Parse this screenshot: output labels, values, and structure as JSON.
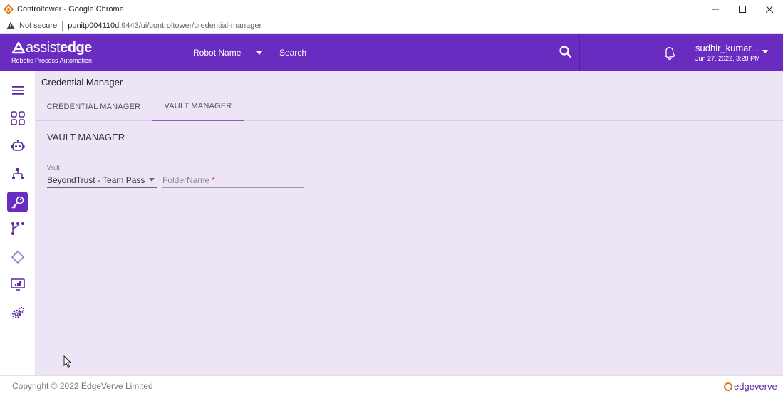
{
  "window": {
    "title": "Controltower - Google Chrome",
    "controls": [
      "minimize",
      "maximize",
      "close"
    ]
  },
  "addressbar": {
    "security_label": "Not secure",
    "url_host": "punitp004110d",
    "url_rest": ":9443/ui/controltower/credential-manager"
  },
  "header": {
    "logo_light": "assist",
    "logo_bold": "edge",
    "logo_tagline": "Robotic Process Automation",
    "robot_select_label": "Robot Name",
    "search_placeholder": "Search",
    "user_name": "sudhir_kumar...",
    "user_datetime": "Jun 27, 2022, 3:28 PM",
    "accent_color": "#6a2cc0"
  },
  "sidebar": {
    "items": [
      {
        "icon": "hamburger-menu-icon",
        "active": false
      },
      {
        "icon": "dashboard-grid-icon",
        "active": false
      },
      {
        "icon": "robot-icon",
        "active": false
      },
      {
        "icon": "hierarchy-icon",
        "active": false
      },
      {
        "icon": "key-icon",
        "active": true
      },
      {
        "icon": "workflow-icon",
        "active": false
      },
      {
        "icon": "chip-icon",
        "active": false
      },
      {
        "icon": "monitor-chart-icon",
        "active": false
      },
      {
        "icon": "settings-gears-icon",
        "active": false
      }
    ]
  },
  "main": {
    "page_title": "Credential Manager",
    "tabs": [
      {
        "label": "CREDENTIAL MANAGER",
        "active": false
      },
      {
        "label": "VAULT MANAGER",
        "active": true
      }
    ],
    "section_title": "VAULT MANAGER",
    "vault_label": "Vault",
    "vault_value": "BeyondTrust - Team Pass...",
    "folder_placeholder": "FolderName",
    "folder_required_mark": "*"
  },
  "footer": {
    "copyright": "Copyright © 2022 EdgeVerve Limited",
    "brand": "edgeverve"
  }
}
